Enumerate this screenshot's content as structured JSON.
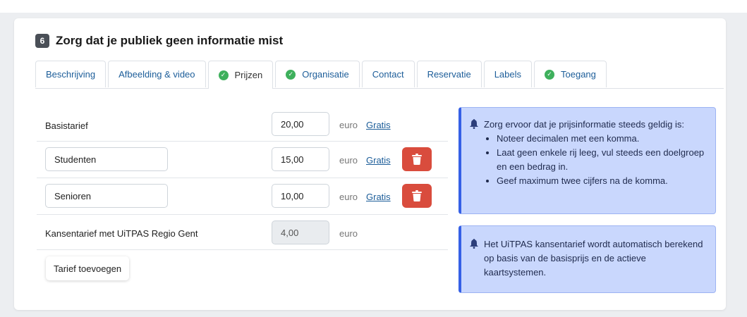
{
  "step": {
    "number": "6",
    "title": "Zorg dat je publiek geen informatie mist"
  },
  "tabs": [
    {
      "label": "Beschrijving",
      "checked": false,
      "active": false
    },
    {
      "label": "Afbeelding & video",
      "checked": false,
      "active": false
    },
    {
      "label": "Prijzen",
      "checked": true,
      "active": true
    },
    {
      "label": "Organisatie",
      "checked": true,
      "active": false
    },
    {
      "label": "Contact",
      "checked": false,
      "active": false
    },
    {
      "label": "Reservatie",
      "checked": false,
      "active": false
    },
    {
      "label": "Labels",
      "checked": false,
      "active": false
    },
    {
      "label": "Toegang",
      "checked": true,
      "active": false
    }
  ],
  "prices": {
    "unit": "euro",
    "free_label": "Gratis",
    "rows": [
      {
        "label": "Basistarief",
        "price": "20,00"
      },
      {
        "target": "Studenten",
        "price": "15,00"
      },
      {
        "target": "Senioren",
        "price": "10,00"
      },
      {
        "label": "Kansentarief met UiTPAS Regio Gent",
        "price": "4,00"
      }
    ],
    "add_label": "Tarief toevoegen"
  },
  "alerts": {
    "info1": {
      "text": "Zorg ervoor dat je prijsinformatie steeds geldig is:",
      "items": [
        "Noteer decimalen met een komma.",
        "Laat geen enkele rij leeg, vul steeds een doelgroep en een bedrag in.",
        "Geef maximum twee cijfers na de komma."
      ]
    },
    "info2": {
      "text": "Het UiTPAS kansentarief wordt automatisch berekend op basis van de basisprijs en de actieve kaartsystemen."
    }
  },
  "icons": {
    "tab_check": "check-circle-icon",
    "delete": "trash-icon",
    "alert": "bell-icon"
  },
  "colors": {
    "link": "#1c5d99",
    "check": "#3eb05c",
    "delete": "#d94c3d",
    "alert_bg": "#c9d7fd",
    "alert_border": "#3560e6"
  }
}
